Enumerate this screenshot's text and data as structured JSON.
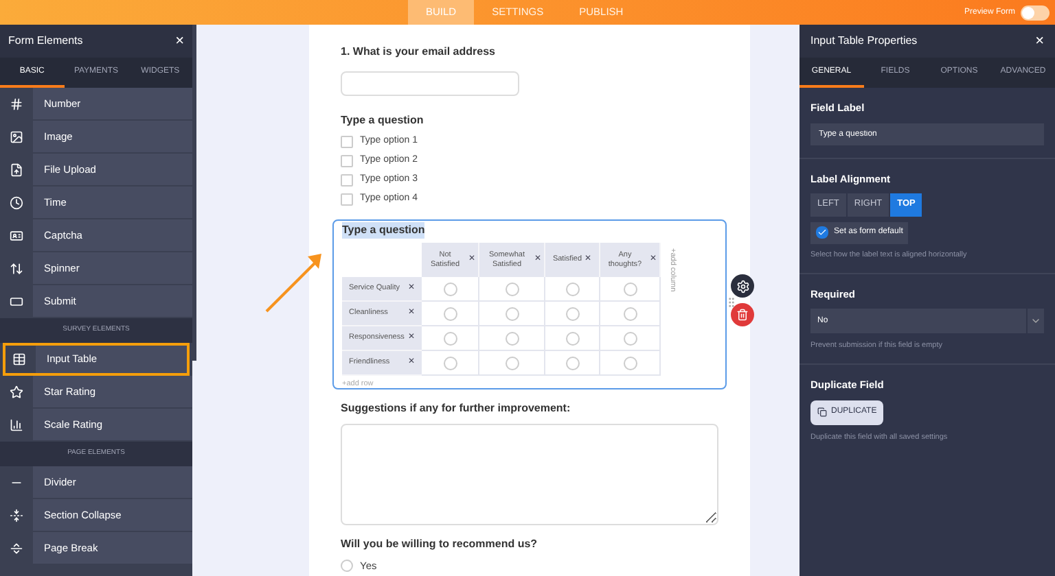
{
  "top_nav": {
    "tabs": [
      {
        "label": "BUILD",
        "selected": true
      },
      {
        "label": "SETTINGS",
        "selected": false
      },
      {
        "label": "PUBLISH",
        "selected": false
      }
    ],
    "preview": {
      "label": "Preview Form",
      "on": false
    }
  },
  "left_panel": {
    "title": "Form Elements",
    "close": "×",
    "tabs": [
      {
        "label": "BASIC",
        "selected": true
      },
      {
        "label": "PAYMENTS",
        "selected": false
      },
      {
        "label": "WIDGETS",
        "selected": false
      }
    ],
    "items": [
      {
        "kind": "item",
        "label": "Number",
        "selected": false
      },
      {
        "kind": "item",
        "label": "Image",
        "selected": false
      },
      {
        "kind": "item",
        "label": "File Upload",
        "selected": false
      },
      {
        "kind": "item",
        "label": "Time",
        "selected": false
      },
      {
        "kind": "item",
        "label": "Captcha",
        "selected": false
      },
      {
        "kind": "item",
        "label": "Spinner",
        "selected": false
      },
      {
        "kind": "item",
        "label": "Submit",
        "selected": false
      },
      {
        "kind": "header",
        "label": "SURVEY ELEMENTS"
      },
      {
        "kind": "item",
        "label": "Input Table",
        "selected": true
      },
      {
        "kind": "item",
        "label": "Star Rating",
        "selected": false
      },
      {
        "kind": "item",
        "label": "Scale Rating",
        "selected": false
      },
      {
        "kind": "header",
        "label": "PAGE ELEMENTS"
      },
      {
        "kind": "item",
        "label": "Divider",
        "selected": false
      },
      {
        "kind": "item",
        "label": "Section Collapse",
        "selected": false
      },
      {
        "kind": "item",
        "label": "Page Break",
        "selected": false
      }
    ]
  },
  "form": [
    {
      "kind": "text_input",
      "label": "1. What is your email address"
    },
    {
      "kind": "checkbox_group",
      "label": "Type a question",
      "options": [
        {
          "label": "Type option 1",
          "checked": false
        },
        {
          "label": "Type option 2",
          "checked": false
        },
        {
          "label": "Type option 3",
          "checked": false
        },
        {
          "label": "Type option 4",
          "checked": false
        }
      ]
    },
    {
      "kind": "input_table",
      "label": "Type a question",
      "selected": true,
      "remove": "✕",
      "columns": [
        "Not Satisfied",
        "Somewhat Satisfied",
        "Satisfied",
        "Any thoughts?"
      ],
      "rows": [
        "Service Quality",
        "Cleanliness",
        "Responsiveness",
        "Friendliness"
      ],
      "add_column": "+add column",
      "add_row": "+add row"
    },
    {
      "kind": "textarea",
      "label": "Suggestions if any for further improvement:"
    },
    {
      "kind": "radio_group",
      "label": "Will you be willing to recommend us?",
      "options": [
        {
          "label": "Yes",
          "selected": false
        }
      ]
    }
  ],
  "right_panel": {
    "title": "Input Table Properties",
    "close": "×",
    "tabs": [
      {
        "label": "GENERAL",
        "selected": true
      },
      {
        "label": "FIELDS",
        "selected": false
      },
      {
        "label": "OPTIONS",
        "selected": false
      },
      {
        "label": "ADVANCED",
        "selected": false
      }
    ],
    "field_label": {
      "label": "Field Label",
      "value": "Type a question"
    },
    "label_alignment": {
      "label": "Label Alignment",
      "options": [
        {
          "label": "LEFT",
          "selected": false
        },
        {
          "label": "RIGHT",
          "selected": false
        },
        {
          "label": "TOP",
          "selected": true
        }
      ],
      "form_default": {
        "label": "Set as form default",
        "checked": true
      },
      "help": "Select how the label text is aligned horizontally"
    },
    "required": {
      "label": "Required",
      "value": "No",
      "help": "Prevent submission if this field is empty"
    },
    "duplicate": {
      "label": "Duplicate Field",
      "button": "DUPLICATE",
      "help": "Duplicate this field with all saved settings"
    }
  }
}
